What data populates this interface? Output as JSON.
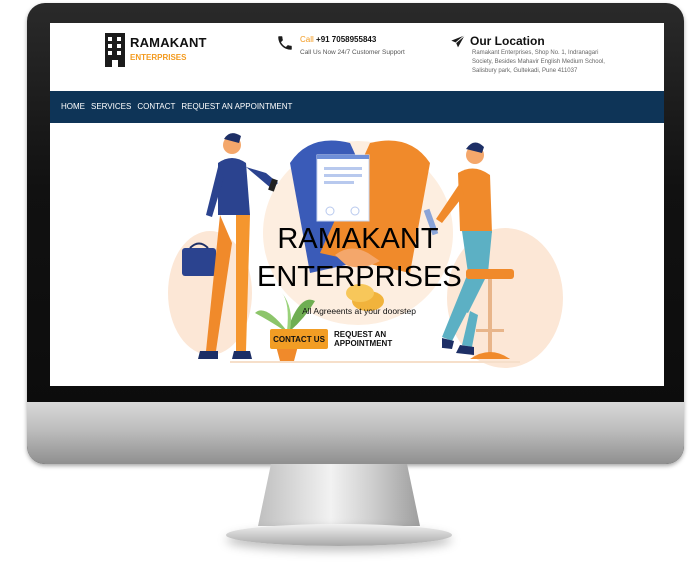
{
  "brand": {
    "name": "RAMAKANT",
    "sub": "ENTERPRISES"
  },
  "contact": {
    "call_label": "Call",
    "phone": "+91 7058955843",
    "support": "Call Us Now 24/7 Customer Support"
  },
  "location": {
    "title": "Our Location",
    "address": "Ramakant Enterprises, Shop No. 1, Indranagari Society, Besides Mahavir English Medium School, Salisbury park, Gultekadi, Pune 411037"
  },
  "nav": {
    "items": [
      {
        "label": "HOME"
      },
      {
        "label": "SERVICES"
      },
      {
        "label": "CONTACT"
      },
      {
        "label": "REQUEST AN APPOINTMENT"
      }
    ]
  },
  "hero": {
    "title_line1": "RAMAKANT",
    "title_line2": "ENTERPRISES",
    "subtitle": "All Agreeents at your doorstep",
    "primary_button": "CONTACT US",
    "secondary_button": "REQUEST AN APPOINTMENT"
  },
  "colors": {
    "nav_bg": "#0e3457",
    "accent": "#f29d24",
    "monitor_frame": "#111111"
  },
  "icons": [
    "building-icon",
    "phone-icon",
    "send-icon"
  ]
}
